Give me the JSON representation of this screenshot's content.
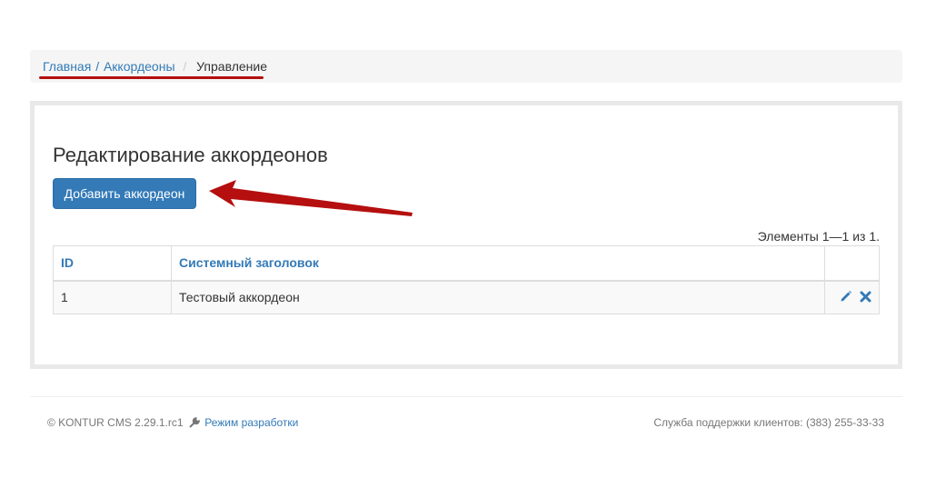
{
  "breadcrumb": {
    "home": "Главная",
    "accordions": "Аккордеоны",
    "separator": "/",
    "current": "Управление"
  },
  "page": {
    "title": "Редактирование аккордеонов",
    "add_button": "Добавить аккордеон",
    "summary": "Элементы 1—1 из 1."
  },
  "table": {
    "headers": {
      "id": "ID",
      "title": "Системный заголовок"
    },
    "rows": [
      {
        "id": "1",
        "title": "Тестовый аккордеон"
      }
    ]
  },
  "footer": {
    "copyright": "© KONTUR CMS 2.29.1.rc1",
    "dev_mode": "Режим разработки",
    "support": "Служба поддержки клиентов: (383) 255-33-33"
  },
  "icons": {
    "edit": "pencil-icon",
    "delete": "close-icon",
    "dev": "wrench-icon"
  },
  "colors": {
    "link": "#337ab7",
    "annotation": "#b50f0f",
    "panel_border": "#e9e9e9"
  }
}
